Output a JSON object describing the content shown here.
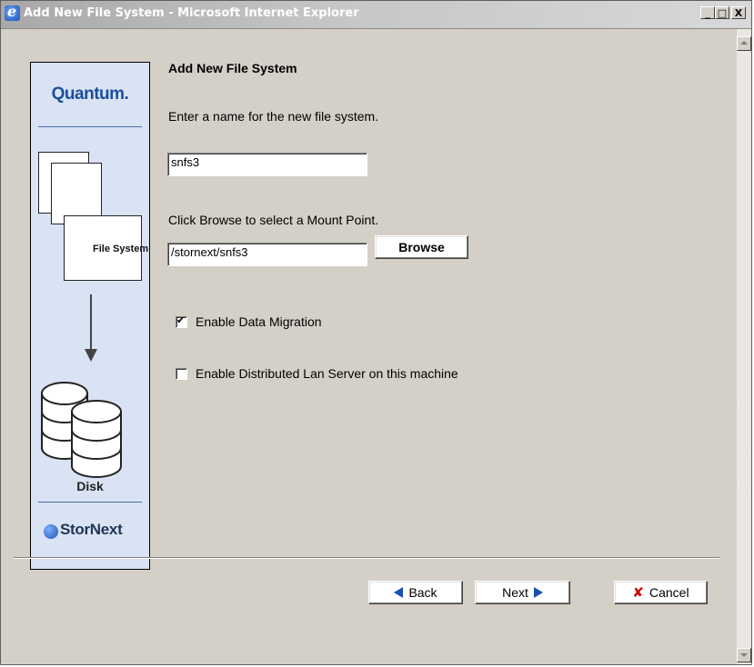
{
  "window": {
    "title": "Add New File System - Microsoft Internet Explorer",
    "minimize_label": "_",
    "maximize_label": "□",
    "close_label": "X"
  },
  "sidebar": {
    "brand": "Quantum.",
    "step1_label": "File System",
    "step2_label": "Disk",
    "footer_brand": "StorNext"
  },
  "form": {
    "heading": "Add New File System",
    "name_prompt": "Enter a name for the new file system.",
    "name_value": "snfs3",
    "mount_prompt": "Click Browse to select a Mount Point.",
    "mount_value": "/stornext/snfs3",
    "browse_label": "Browse",
    "data_migration_label": "Enable Data Migration",
    "data_migration_checked": true,
    "dlan_label": "Enable Distributed Lan Server on this machine",
    "dlan_checked": false
  },
  "nav": {
    "back_label": "Back",
    "next_label": "Next",
    "cancel_label": "Cancel"
  }
}
